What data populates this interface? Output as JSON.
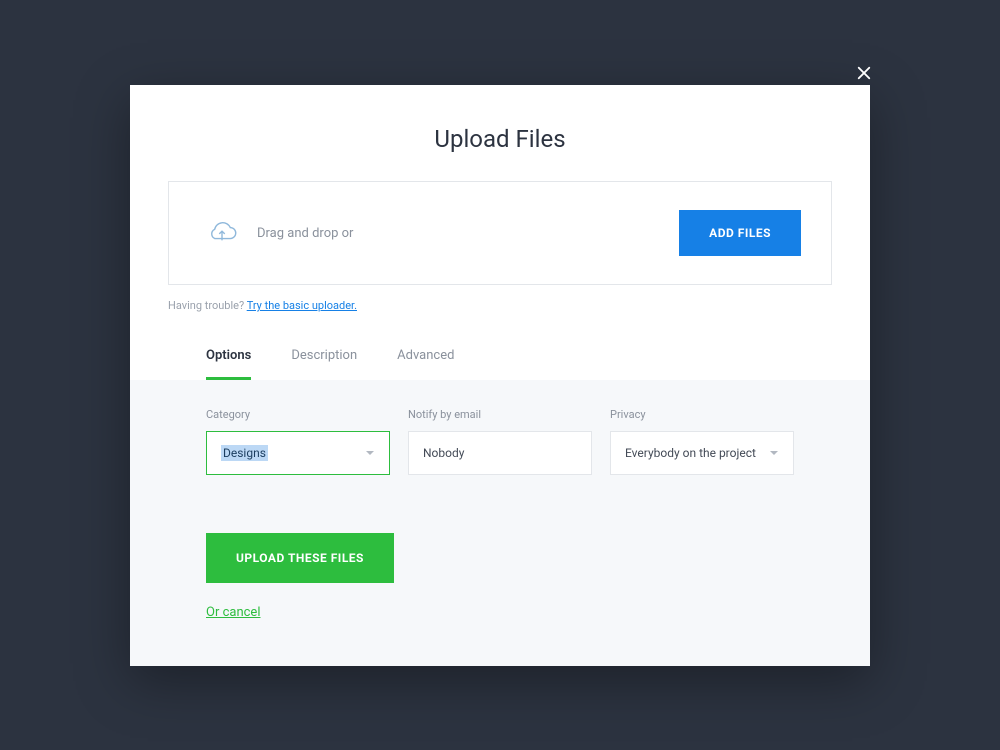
{
  "modal": {
    "title": "Upload Files",
    "drag_text": "Drag and drop or",
    "add_files_label": "ADD FILES",
    "trouble_text": "Having trouble? ",
    "trouble_link": "Try the basic uploader."
  },
  "tabs": [
    {
      "label": "Options",
      "active": true
    },
    {
      "label": "Description",
      "active": false
    },
    {
      "label": "Advanced",
      "active": false
    }
  ],
  "options": {
    "category": {
      "label": "Category",
      "value": "Designs"
    },
    "notify": {
      "label": "Notify by email",
      "value": "Nobody"
    },
    "privacy": {
      "label": "Privacy",
      "value": "Everybody on the project"
    }
  },
  "actions": {
    "upload_label": "UPLOAD THESE FILES",
    "cancel_label": "Or cancel"
  },
  "colors": {
    "accent_blue": "#1680e6",
    "accent_green": "#2dbd3e",
    "background": "#2c3340"
  }
}
